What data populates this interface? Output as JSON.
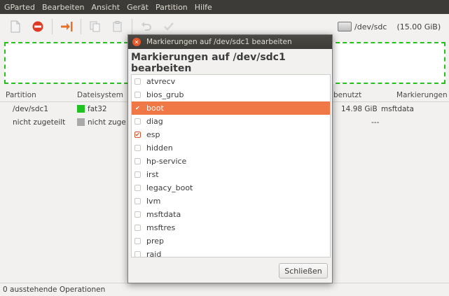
{
  "menubar": {
    "items": [
      "GParted",
      "Bearbeiten",
      "Ansicht",
      "Gerät",
      "Partition",
      "Hilfe"
    ]
  },
  "toolbar": {
    "icons": [
      "new-partition-icon",
      "delete-icon",
      "resize-move-icon",
      "copy-icon",
      "paste-icon",
      "undo-icon",
      "apply-icon"
    ],
    "device": "/dev/sdc",
    "device_size": "(15.00 GiB)"
  },
  "table": {
    "headers": [
      "Partition",
      "Dateisystem",
      "benutzt",
      "Markierungen"
    ],
    "rows": [
      {
        "partition": "/dev/sdc1",
        "fs": "fat32",
        "fs_color": "#21c121",
        "unused": "14.98 GiB",
        "flags": "msftdata"
      },
      {
        "partition": "nicht zugeteilt",
        "fs": "nicht zuge",
        "fs_color": "#a9a9a9",
        "unused": "---",
        "flags": ""
      }
    ]
  },
  "status": {
    "text": "0 ausstehende Operationen"
  },
  "dialog": {
    "title": "Markierungen auf /dev/sdc1 bearbeiten",
    "heading": "Markierungen auf /dev/sdc1 bearbeiten",
    "flags": [
      {
        "label": "atvrecv",
        "checked": false,
        "selected": false
      },
      {
        "label": "bios_grub",
        "checked": false,
        "selected": false
      },
      {
        "label": "boot",
        "checked": true,
        "selected": true
      },
      {
        "label": "diag",
        "checked": false,
        "selected": false
      },
      {
        "label": "esp",
        "checked": true,
        "selected": false
      },
      {
        "label": "hidden",
        "checked": false,
        "selected": false
      },
      {
        "label": "hp-service",
        "checked": false,
        "selected": false
      },
      {
        "label": "irst",
        "checked": false,
        "selected": false
      },
      {
        "label": "legacy_boot",
        "checked": false,
        "selected": false
      },
      {
        "label": "lvm",
        "checked": false,
        "selected": false
      },
      {
        "label": "msftdata",
        "checked": false,
        "selected": false
      },
      {
        "label": "msftres",
        "checked": false,
        "selected": false
      },
      {
        "label": "prep",
        "checked": false,
        "selected": false
      },
      {
        "label": "raid",
        "checked": false,
        "selected": false
      }
    ],
    "close_label": "Schließen"
  },
  "colors": {
    "accent": "#f07746",
    "titlebar": "#3c3b37",
    "graph_border": "#26c11e"
  }
}
